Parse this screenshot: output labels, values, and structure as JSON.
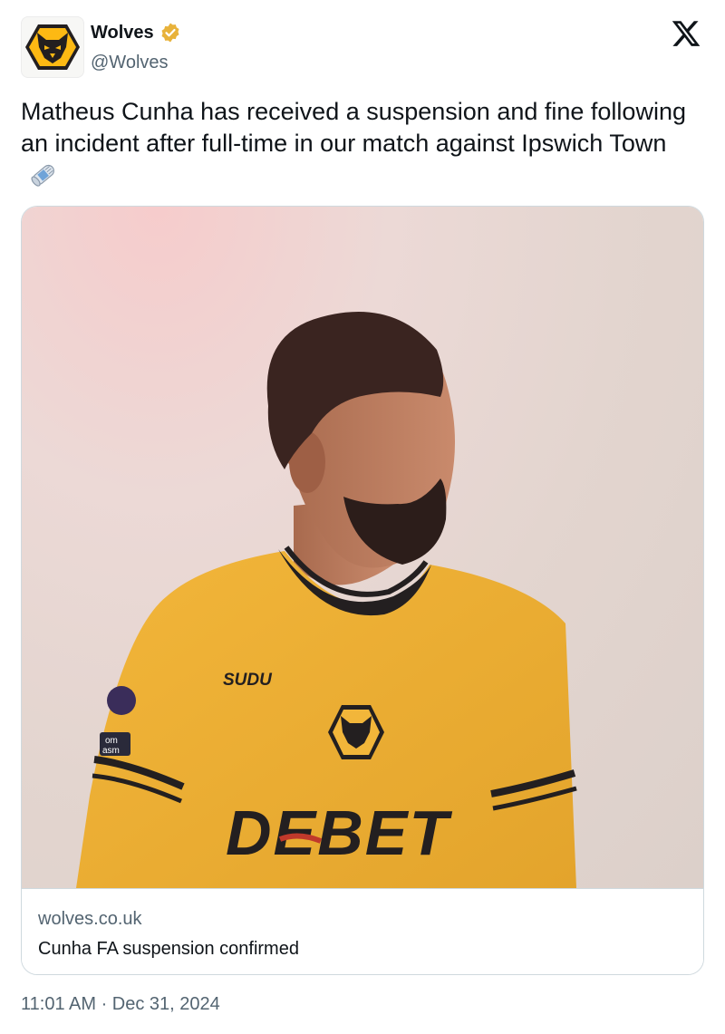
{
  "author": {
    "display_name": "Wolves",
    "handle": "@Wolves",
    "verified": true,
    "avatar_icon": "wolves-crest-icon",
    "verified_badge_color": "#e8b23a"
  },
  "platform": {
    "logo_icon": "x-logo-icon"
  },
  "tweet": {
    "text": "Matheus Cunha has received a suspension and fine following an incident after full-time in our match against Ipswich Town",
    "emoji_icon": "newspaper-icon",
    "timestamp": "11:01 AM · Dec 31, 2024"
  },
  "card": {
    "image_icon": "player-photo",
    "shirt_sponsor_top": "SUDU",
    "shirt_sponsor_main": "DEBET",
    "sleeve_badge": "om\nasm",
    "domain": "wolves.co.uk",
    "title": "Cunha FA suspension confirmed"
  },
  "colors": {
    "wolves_gold": "#fdb913",
    "wolves_black": "#231f20",
    "text_primary": "#0f1419",
    "text_secondary": "#536471",
    "border": "#cfd9de"
  }
}
